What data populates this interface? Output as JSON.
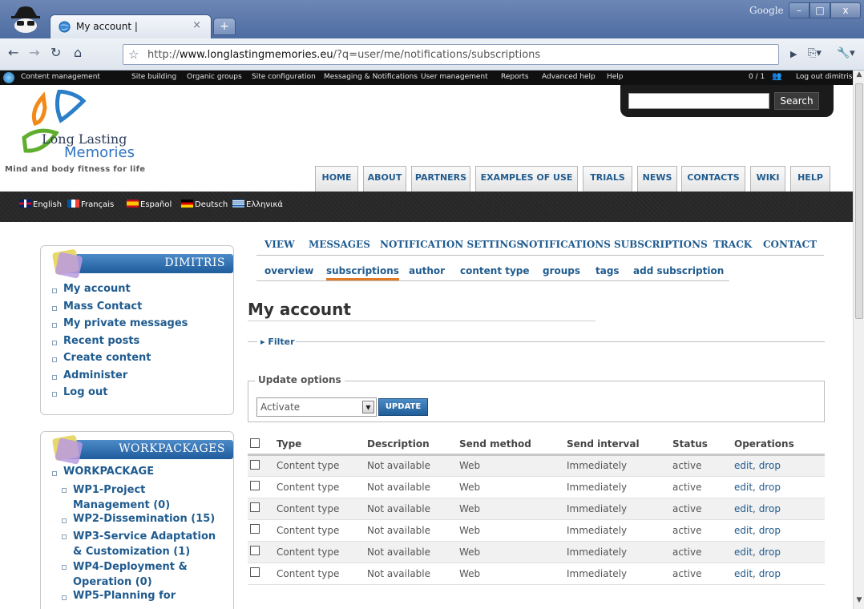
{
  "browser": {
    "tab_title": "My account |",
    "tab_close": "×",
    "new_tab": "+",
    "brand": "Google",
    "window_min": "–",
    "window_max": "□",
    "window_close": "x",
    "url_prefix": "http://",
    "url_host": "www.longlastingmemories.eu",
    "url_path": "/?q=user/me/notifications/subscriptions",
    "go": "▶",
    "page_menu": "⎘▾",
    "tools_menu": "🔧▾"
  },
  "admin_menu": {
    "items": [
      "Content management",
      "Site building",
      "Organic groups",
      "Site configuration",
      "Messaging & Notifications",
      "User management",
      "Reports",
      "Advanced help",
      "Help"
    ],
    "counter": "0 / 1",
    "logout": "Log out dimitris"
  },
  "header": {
    "logo_line1": "Long Lasting",
    "logo_line2": "Memories",
    "tagline": "Mind and body fitness for life",
    "search_button": "Search",
    "search_placeholder": "",
    "nav": [
      "HOME",
      "ABOUT",
      "PARTNERS",
      "EXAMPLES OF USE",
      "TRIALS",
      "NEWS",
      "CONTACTS",
      "WIKI",
      "HELP"
    ]
  },
  "languages": [
    "English",
    "Français",
    "Español",
    "Deutsch",
    "Ελληνικά"
  ],
  "sidebar": {
    "user_block": {
      "title": "DIMITRIS",
      "items": [
        "My account",
        "Mass Contact",
        "My private messages",
        "Recent posts",
        "Create content",
        "Administer",
        "Log out"
      ]
    },
    "workpackages": {
      "title": "WORKPACKAGES",
      "root": "WORKPACKAGE",
      "items": [
        "WP1-Project Management (0)",
        "WP2-Dissemination (15)",
        "WP3-Service Adaptation & Customization (1)",
        "WP4-Deployment & Operation (0)",
        "WP5-Planning for"
      ]
    }
  },
  "content": {
    "primary_tabs": [
      "VIEW",
      "MESSAGES",
      "NOTIFICATION SETTINGS",
      "NOTIFICATIONS",
      "SUBSCRIPTIONS",
      "TRACK",
      "CONTACT"
    ],
    "secondary_tabs": [
      "overview",
      "subscriptions",
      "author",
      "content type",
      "groups",
      "tags",
      "add subscription"
    ],
    "active_secondary": "subscriptions",
    "title": "My account",
    "filter_label": "Filter",
    "update_options": {
      "legend": "Update options",
      "selected": "Activate",
      "button": "UPDATE"
    },
    "table": {
      "headers": [
        "Type",
        "Description",
        "Send method",
        "Send interval",
        "Status",
        "Operations"
      ],
      "rows": [
        {
          "type": "Content type",
          "description": "Not available",
          "method": "Web",
          "interval": "Immediately",
          "status": "active",
          "edit": "edit",
          "drop": "drop"
        },
        {
          "type": "Content type",
          "description": "Not available",
          "method": "Web",
          "interval": "Immediately",
          "status": "active",
          "edit": "edit",
          "drop": "drop"
        },
        {
          "type": "Content type",
          "description": "Not available",
          "method": "Web",
          "interval": "Immediately",
          "status": "active",
          "edit": "edit",
          "drop": "drop"
        },
        {
          "type": "Content type",
          "description": "Not available",
          "method": "Web",
          "interval": "Immediately",
          "status": "active",
          "edit": "edit",
          "drop": "drop"
        },
        {
          "type": "Content type",
          "description": "Not available",
          "method": "Web",
          "interval": "Immediately",
          "status": "active",
          "edit": "edit",
          "drop": "drop"
        },
        {
          "type": "Content type",
          "description": "Not available",
          "method": "Web",
          "interval": "Immediately",
          "status": "active",
          "edit": "edit",
          "drop": "drop"
        }
      ]
    }
  },
  "colors": {
    "link_blue": "#1f5b8f",
    "active_tab_underline": "#e07a26",
    "block_header": "#2f6fb0"
  }
}
